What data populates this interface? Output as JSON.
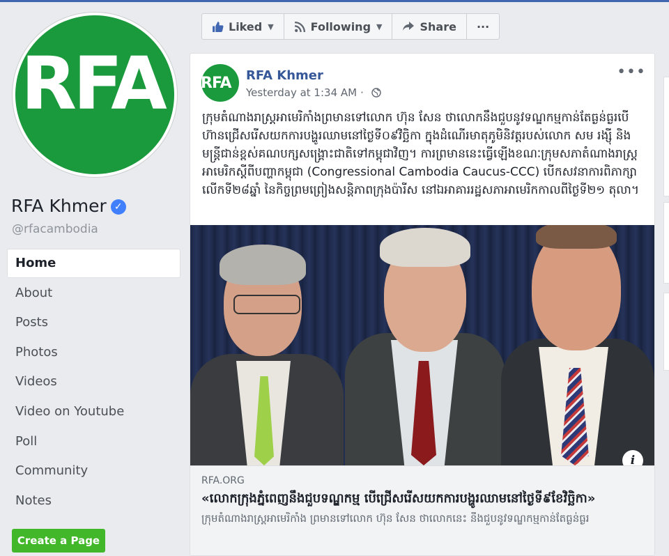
{
  "page": {
    "name": "RFA Khmer",
    "handle": "@rfacambodia",
    "logo_text": "RFA"
  },
  "nav": {
    "items": [
      "Home",
      "About",
      "Posts",
      "Photos",
      "Videos",
      "Video on Youtube",
      "Poll",
      "Community",
      "Notes"
    ],
    "active": "Home"
  },
  "create_page_label": "Create a Page",
  "actions": {
    "liked": "Liked",
    "following": "Following",
    "share": "Share",
    "more": "···"
  },
  "post": {
    "author": "RFA Khmer",
    "timestamp": "Yesterday at 1:34 AM",
    "separator": "·",
    "more": "•••",
    "text": "ក្រុមតំណាងរាស្ត្រអាមេរិកាំងព្រមានទៅលោក ហ៊ុន សែន ថាលោកនឹងជួបនូវទណ្ឌកម្មកាន់តែធ្ងន់ធ្ងរបើហ៊ានជ្រើសរើសយកការបង្ហូរឈាមនៅថ្ងៃទី០៩វិច្ឆិកា ក្នុងដំណើរមាតុភូមិនិវត្តរបស់លោក សម រង្ស៊ី និងមន្ត្រីជាន់ខ្ពស់គណបក្សសង្គ្រោះជាតិទៅកម្ពុជាវិញ។ ការព្រមាននេះធ្វើឡើងខណៈក្រុមសភាតំណាងរាស្ត្រអាមេរិកស្តីពីបញ្ហាកម្ពុជា (Congressional Cambodia Caucus-CCC) បើកសវនាការពិភាក្សាលើកទី២៨ឆ្នាំ នៃកិច្ចព្រមព្រៀងសន្តិភាពក្រុងប៉ារីស នៅឯអាគាររដ្ឋសភាអាមេរិកកាលពីថ្ងៃទី២១ តុលា។",
    "info": "i"
  },
  "link": {
    "domain": "RFA.ORG",
    "title": "«លោកក្រុងភ្នំពេញនឹងជួបទណ្ឌកម្ម បើជ្រើសរើសយកការបង្ហូរឈាមនៅថ្ងៃទី៩ខែវិច្ឆិកា»",
    "description": "ក្រុមតំណាងរាស្ត្រអាមេរិកាំង ព្រមានទៅលោក ហ៊ុន សែន ថាលោកនេះ នឹងជួបនូវទណ្ឌកម្មកាន់តែធ្ងន់ធ្ងរ"
  },
  "colors": {
    "brand_green": "#1a9a3c",
    "link_blue": "#365899",
    "fb_blue": "#4267b2",
    "create_green": "#42b72a"
  }
}
